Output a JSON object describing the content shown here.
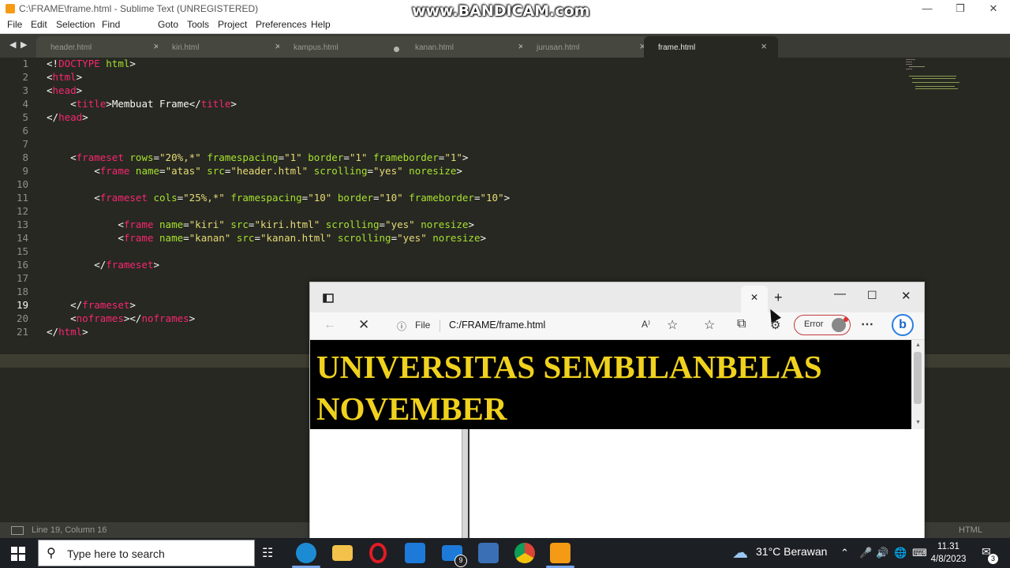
{
  "sublime": {
    "title": "C:\\FRAME\\frame.html - Sublime Text (UNREGISTERED)",
    "menu": [
      "File",
      "Edit",
      "Selection",
      "Find",
      "Goto",
      "Tools",
      "Project",
      "Preferences",
      "Help"
    ],
    "tabs": [
      {
        "label": "header.html",
        "modified": false,
        "active": false
      },
      {
        "label": "kiri.html",
        "modified": false,
        "active": false
      },
      {
        "label": "kampus.html",
        "modified": true,
        "active": false
      },
      {
        "label": "kanan.html",
        "modified": false,
        "active": false
      },
      {
        "label": "jurusan.html",
        "modified": false,
        "active": false
      },
      {
        "label": "frame.html",
        "modified": false,
        "active": true
      }
    ],
    "line_numbers": [
      "1",
      "2",
      "3",
      "4",
      "5",
      "6",
      "7",
      "8",
      "9",
      "10",
      "11",
      "12",
      "13",
      "14",
      "15",
      "16",
      "17",
      "18",
      "19",
      "20",
      "21"
    ],
    "current_line": 19,
    "code_lines": [
      "<!DOCTYPE html>",
      "<html>",
      "<head>",
      "    <title>Membuat Frame</title>",
      "</head>",
      "",
      "",
      "    <frameset rows=\"20%,*\" framespacing=\"1\" border=\"1\" frameborder=\"1\">",
      "        <frame name=\"atas\" src=\"header.html\" scrolling=\"yes\" noresize>",
      "",
      "        <frameset cols=\"25%,*\" framespacing=\"10\" border=\"10\" frameborder=\"10\">",
      "",
      "            <frame name=\"kiri\" src=\"kiri.html\" scrolling=\"yes\" noresize>",
      "            <frame name=\"kanan\" src=\"kanan.html\" scrolling=\"yes\" noresize>",
      "",
      "        </frameset>",
      "",
      "",
      "    </frameset>",
      "    <noframes></noframes>",
      "</html>"
    ],
    "status_position": "Line 19, Column 16",
    "status_syntax": "HTML"
  },
  "watermark": "www.BANDICAM.com",
  "edge": {
    "address_scheme": "File",
    "address_url": "C:/FRAME/frame.html",
    "profile_status": "Error",
    "header_text": "UNIVERSITAS SEMBILANBELAS NOVEMBER"
  },
  "taskbar": {
    "search_placeholder": "Type here to search",
    "weather": "31°C  Berawan",
    "time": "11.31",
    "date": "4/8/2023",
    "mail_badge": "9",
    "notification_count": "3"
  },
  "colors": {
    "editor_bg": "#272822",
    "tag": "#f92672",
    "attr": "#a6e22e",
    "string": "#e6db74",
    "header_bg": "#000000",
    "header_text": "#f0d21e"
  }
}
